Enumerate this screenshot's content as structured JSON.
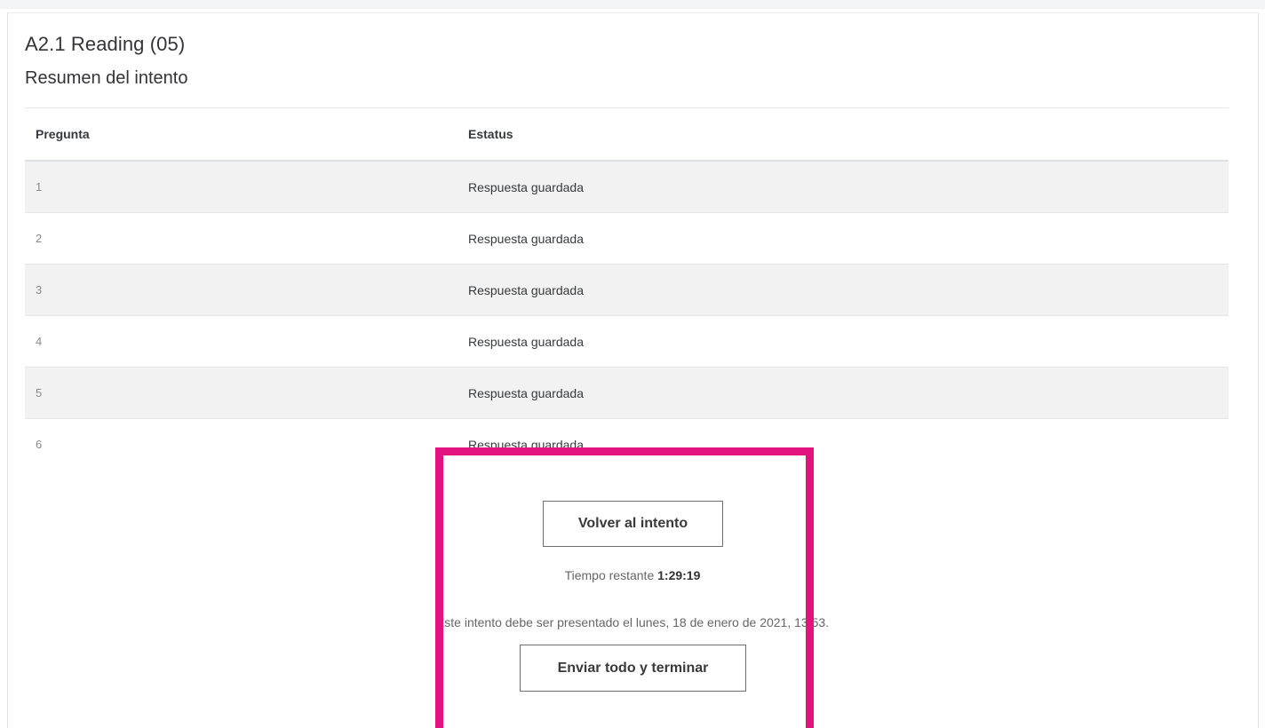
{
  "quiz": {
    "title": "A2.1 Reading (05)",
    "subtitle": "Resumen del intento"
  },
  "table": {
    "headers": [
      "Pregunta",
      "Estatus"
    ],
    "rows": [
      {
        "question": "1",
        "status": "Respuesta guardada"
      },
      {
        "question": "2",
        "status": "Respuesta guardada"
      },
      {
        "question": "3",
        "status": "Respuesta guardada"
      },
      {
        "question": "4",
        "status": "Respuesta guardada"
      },
      {
        "question": "5",
        "status": "Respuesta guardada"
      },
      {
        "question": "6",
        "status": "Respuesta guardada"
      }
    ]
  },
  "actions": {
    "return_label": "Volver al intento",
    "time_left_label": "Tiempo restante",
    "time_left_value": "1:29:19",
    "deadline_text": "Este intento debe ser presentado el lunes, 18 de enero de 2021, 13:53.",
    "submit_label": "Enviar todo y terminar"
  },
  "colors": {
    "highlight": "#e2137f",
    "row_alt": "#f2f2f2"
  }
}
